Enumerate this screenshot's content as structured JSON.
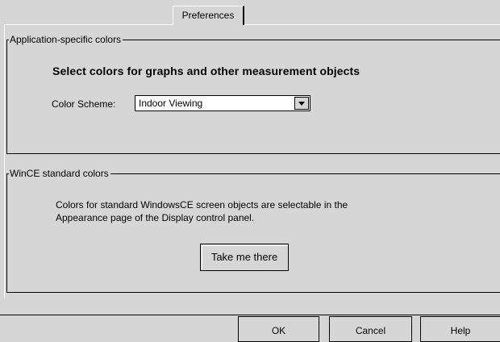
{
  "tab": {
    "label": "Preferences"
  },
  "app_colors": {
    "group_title": "Application-specific colors",
    "heading": "Select colors for graphs and other measurement objects",
    "scheme_label": "Color Scheme:",
    "scheme_value": "Indoor Viewing"
  },
  "wince_colors": {
    "group_title": "WinCE standard colors",
    "description_line1": "Colors for standard WindowsCE screen objects are selectable in the",
    "description_line2": "Appearance page of the Display control panel.",
    "take_me_label": "Take me there"
  },
  "dialog": {
    "ok_label": "OK",
    "cancel_label": "Cancel",
    "help_label": "Help"
  }
}
